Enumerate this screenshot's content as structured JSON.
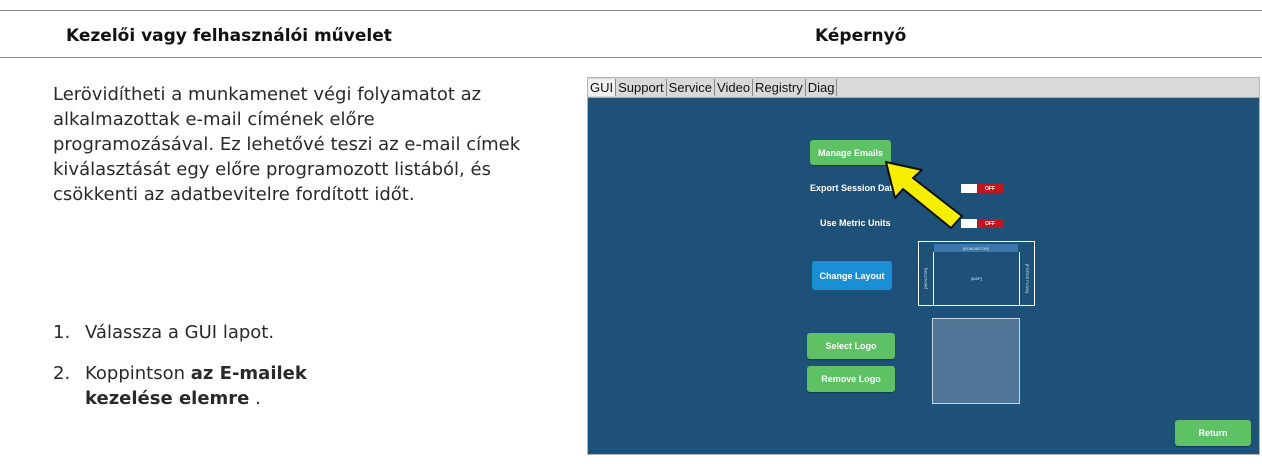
{
  "table": {
    "header_left": "Kezelői vagy felhasználói művelet",
    "header_right": "Képernyő"
  },
  "description": "Lerövidítheti a munkamenet végi folyamatot az alkalmazottak e-mail címének előre programozásával. Ez lehetővé teszi az e-mail címek kiválasztását egy előre programozott listából, és csökkenti az adatbevitelre fordított időt.",
  "steps": [
    {
      "number": "1.",
      "text": "Válassza a GUI lapot."
    },
    {
      "number": "2.",
      "text_before": "Koppintson ",
      "text_bold": "az E-mailek kezelése elemre",
      "text_after": " ."
    }
  ],
  "screen": {
    "tabs": [
      "GUI",
      "Support",
      "Service",
      "Video",
      "Registry",
      "Diag"
    ],
    "manage_emails": "Manage Emails",
    "export_session_data": "Export Session Data",
    "use_metric_units": "Use Metric Units",
    "toggle_off": "OFF",
    "change_layout": "Change Layout",
    "layout_top": "[ELMONITOR]",
    "layout_left": "[MONITOR]",
    "layout_center": "[MAP]",
    "layout_right": "[FORCE FLOW]",
    "select_logo": "Select Logo",
    "remove_logo": "Remove Logo",
    "return": "Return",
    "colors": {
      "background": "#1e5177",
      "green_button": "#5ec163",
      "blue_button": "#1b8fd3",
      "toggle_off": "#c0171f",
      "arrow": "#f5ee00"
    }
  }
}
